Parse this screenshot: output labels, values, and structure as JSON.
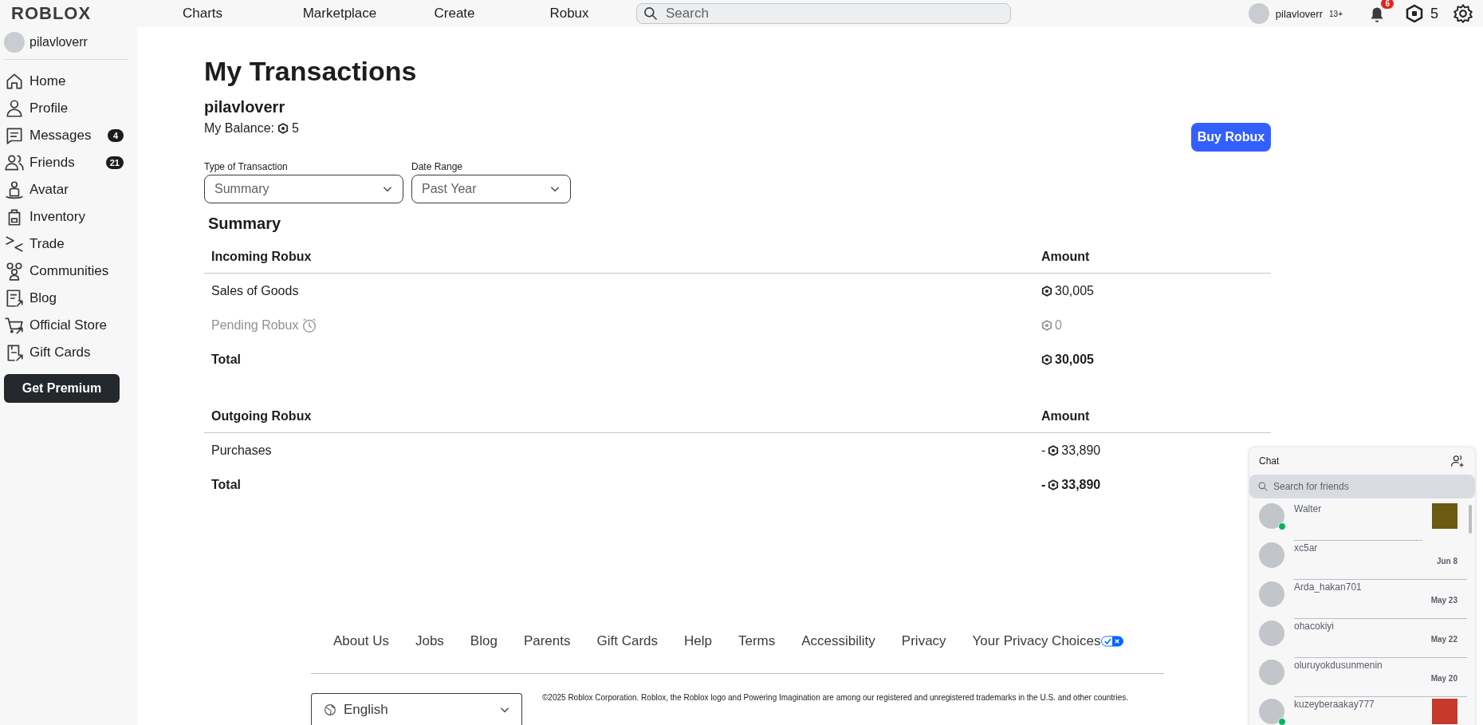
{
  "topbar": {
    "logo": "ROBLOX",
    "nav": [
      "Charts",
      "Marketplace",
      "Create",
      "Robux"
    ],
    "search": {
      "placeholder": "Search"
    },
    "username": "pilavloverr",
    "age": "13+",
    "notifications": "6",
    "robux": "5"
  },
  "sidebar": {
    "username": "pilavloverr",
    "items": [
      {
        "label": "Home"
      },
      {
        "label": "Profile"
      },
      {
        "label": "Messages",
        "badge": "4"
      },
      {
        "label": "Friends",
        "badge": "21"
      },
      {
        "label": "Avatar"
      },
      {
        "label": "Inventory"
      },
      {
        "label": "Trade"
      },
      {
        "label": "Communities"
      },
      {
        "label": "Blog"
      },
      {
        "label": "Official Store"
      },
      {
        "label": "Gift Cards"
      }
    ],
    "premium_button": "Get Premium"
  },
  "main": {
    "title": "My Transactions",
    "username": "pilavloverr",
    "balance_label": "My Balance:",
    "balance": "5",
    "buy_button": "Buy Robux",
    "filters": [
      {
        "label": "Type of Transaction",
        "value": "Summary"
      },
      {
        "label": "Date Range",
        "value": "Past Year"
      }
    ],
    "summary_title": "Summary",
    "tables": [
      {
        "header": "Incoming Robux",
        "amount_header": "Amount",
        "rows": [
          {
            "kind": "normal",
            "label": "Sales of Goods",
            "sign": "",
            "amount": "30,005"
          },
          {
            "kind": "pending",
            "label": "Pending Robux",
            "sign": "",
            "amount": "0"
          },
          {
            "kind": "total",
            "label": "Total",
            "sign": "",
            "amount": "30,005"
          }
        ]
      },
      {
        "header": "Outgoing Robux",
        "amount_header": "Amount",
        "rows": [
          {
            "kind": "normal",
            "label": "Purchases",
            "sign": "-",
            "amount": "33,890"
          },
          {
            "kind": "total",
            "label": "Total",
            "sign": "-",
            "amount": "33,890"
          }
        ]
      }
    ]
  },
  "footer": {
    "links": [
      "About Us",
      "Jobs",
      "Blog",
      "Parents",
      "Gift Cards",
      "Help",
      "Terms",
      "Accessibility",
      "Privacy",
      "Your Privacy Choices"
    ],
    "language": "English",
    "copyright": "©2025 Roblox Corporation. Roblox, the Roblox logo and Powering Imagination are among our registered and unregistered trademarks in the U.S. and other countries."
  },
  "chat": {
    "title": "Chat",
    "search": {
      "placeholder": "Search for friends"
    },
    "friends": [
      {
        "name": "Walter",
        "online": true,
        "thumbnail": true
      },
      {
        "name": "xc5ar",
        "online": false,
        "date": "Jun 8"
      },
      {
        "name": "Arda_hakan701",
        "online": false,
        "date": "May 23"
      },
      {
        "name": "ohacokiyi",
        "online": false,
        "date": "May 22"
      },
      {
        "name": "oluruyokdusunmenin",
        "online": false,
        "date": "May 20"
      },
      {
        "name": "kuzeyberaakay777",
        "online": true,
        "thumbnail": true
      }
    ]
  }
}
